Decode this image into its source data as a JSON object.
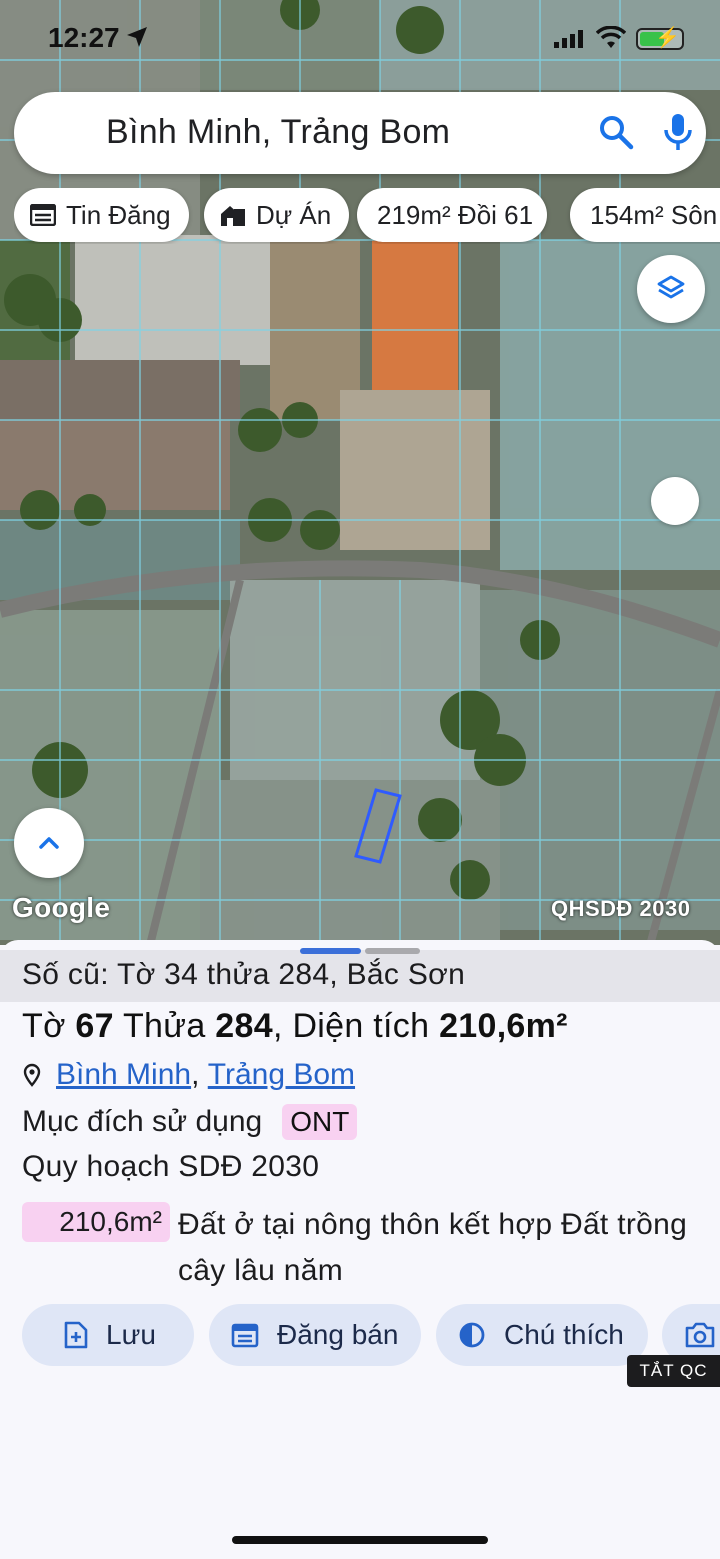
{
  "status_bar": {
    "time": "12:27"
  },
  "search": {
    "query": "Bình Minh, Trảng Bom"
  },
  "chips": [
    {
      "label": "Tin Đăng",
      "icon": "listing-icon"
    },
    {
      "label": "Dự Án",
      "icon": "building-icon"
    },
    {
      "label": "219m² Đồi 61"
    },
    {
      "label": "154m² Sôn"
    }
  ],
  "map": {
    "attribution": "Google",
    "layer_label": "QHSDĐ 2030"
  },
  "sheet": {
    "old_parcel": "Số cũ: Tờ 34 thửa 284, Bắc Sơn",
    "sheet_word": "Tờ",
    "sheet_no": "67",
    "parcel_word": "Thửa",
    "parcel_no": "284",
    "area_word": "Diện tích",
    "area_value": "210,6m²",
    "commune": "Bình Minh",
    "district": "Trảng Bom",
    "purpose_label": "Mục đích sử dụng",
    "purpose_code": "ONT",
    "plan_label": "Quy hoạch SDĐ 2030",
    "plan_area": "210,6m²",
    "plan_landuse": "Đất ở tại nông thôn kết hợp Đất trồng cây lâu năm",
    "colors": {
      "ont": "#f8d1f1",
      "link": "#2563c9",
      "accent": "#3b6fd9"
    }
  },
  "actions": [
    {
      "label": "Lưu",
      "icon": "add-document-icon"
    },
    {
      "label": "Đăng bán",
      "icon": "calendar-icon"
    },
    {
      "label": "Chú thích",
      "icon": "contrast-icon"
    },
    {
      "label": "",
      "icon": "camera-icon"
    }
  ],
  "ad_toggle": "TẮT QC"
}
